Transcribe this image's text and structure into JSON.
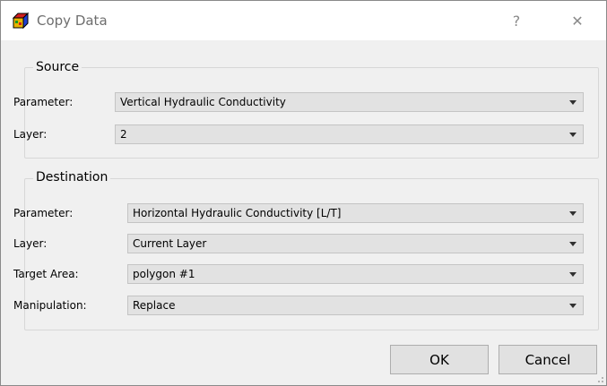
{
  "window": {
    "title": "Copy Data",
    "help_glyph": "?",
    "close_glyph": "✕",
    "icon": "colored-cube-icon"
  },
  "source": {
    "group_title": "Source",
    "parameter_label": "Parameter:",
    "parameter_value": "Vertical Hydraulic Conductivity",
    "layer_label": "Layer:",
    "layer_value": "2"
  },
  "destination": {
    "group_title": "Destination",
    "parameter_label": "Parameter:",
    "parameter_value": "Horizontal Hydraulic Conductivity [L/T]",
    "layer_label": "Layer:",
    "layer_value": "Current Layer",
    "target_area_label": "Target Area:",
    "target_area_value": "polygon #1",
    "manipulation_label": "Manipulation:",
    "manipulation_value": "Replace"
  },
  "buttons": {
    "ok": "OK",
    "cancel": "Cancel"
  }
}
